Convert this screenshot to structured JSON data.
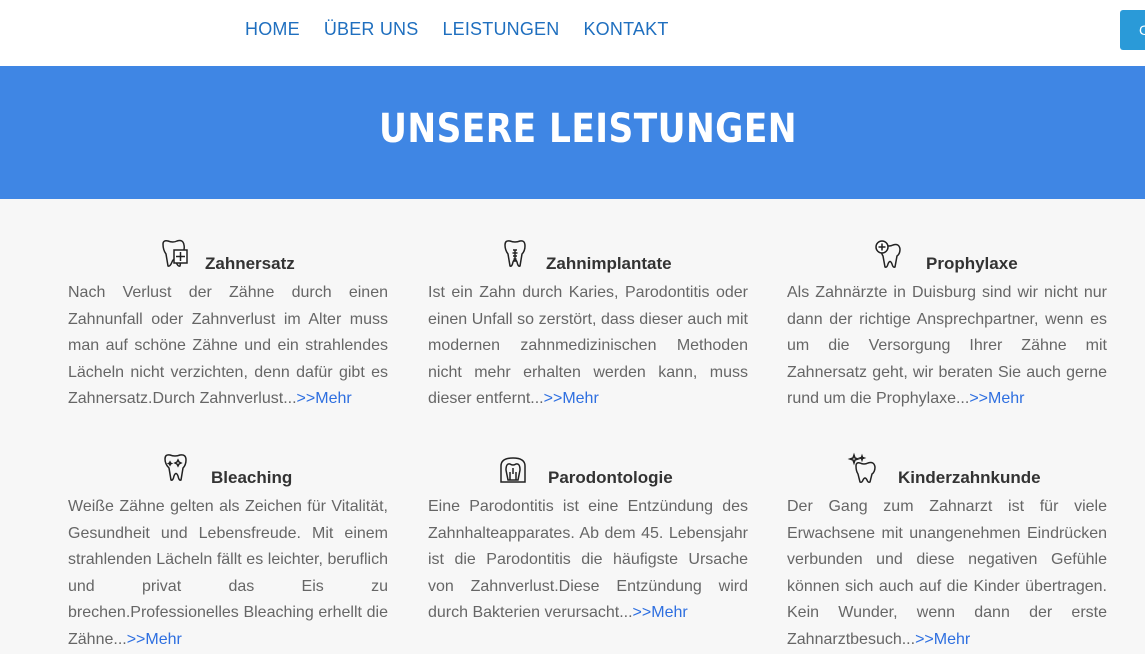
{
  "nav": {
    "items": [
      "HOME",
      "ÜBER UNS",
      "LEISTUNGEN",
      "KONTAKT"
    ],
    "cta_label": "C"
  },
  "hero": {
    "title": "UNSERE LEISTUNGEN"
  },
  "services": [
    {
      "title": "Zahnersatz",
      "icon": "tooth-plus-icon",
      "text": "Nach Verlust der Zähne durch einen Zahnunfall oder Zahnverlust im Alter muss man auf schöne Zähne und ein strahlendes Lächeln nicht verzichten, denn dafür gibt es Zahnersatz.Durch Zahnverlust...",
      "more": ">>Mehr"
    },
    {
      "title": "Zahnimplantate",
      "icon": "tooth-implant-icon",
      "text": "Ist ein Zahn durch Karies, Parodontitis oder einen Unfall so zerstört, dass dieser auch mit modernen zahnmedizinischen Methoden nicht mehr erhalten werden kann, muss dieser entfernt...",
      "more": ">>Mehr"
    },
    {
      "title": "Prophylaxe",
      "icon": "tooth-care-icon",
      "text": "Als Zahnärzte in Duisburg sind wir nicht nur dann der richtige Ansprechpartner, wenn es um die Versorgung Ihrer Zähne mit Zahnersatz geht, wir beraten Sie auch gerne rund um die Prophylaxe...",
      "more": ">>Mehr"
    },
    {
      "title": "Bleaching",
      "icon": "tooth-shine-icon",
      "text": "Weiße Zähne gelten als Zeichen für Vitalität, Gesundheit und Lebensfreude. Mit einem strahlenden Lächeln fällt es leichter, beruflich und privat das Eis zu brechen.Professionelles Bleaching erhellt die Zähne...",
      "more": ">>Mehr"
    },
    {
      "title": "Parodontologie",
      "icon": "gum-icon",
      "text": "Eine Parodontitis ist eine Entzündung des Zahnhalteapparates. Ab dem 45. Lebensjahr ist die Parodontitis die häufigste Ursache von Zahnverlust.Diese Entzündung wird durch Bakterien verursacht...",
      "more": ">>Mehr"
    },
    {
      "title": "Kinderzahnkunde",
      "icon": "tooth-sparkle-icon",
      "text": "Der Gang zum Zahnarzt ist für viele Erwachsene mit unangenehmen Eindrücken verbunden und diese negativen Gefühle können sich auch auf die Kinder übertragen. Kein Wunder, wenn dann der erste Zahnarztbesuch...",
      "more": ">>Mehr"
    }
  ]
}
